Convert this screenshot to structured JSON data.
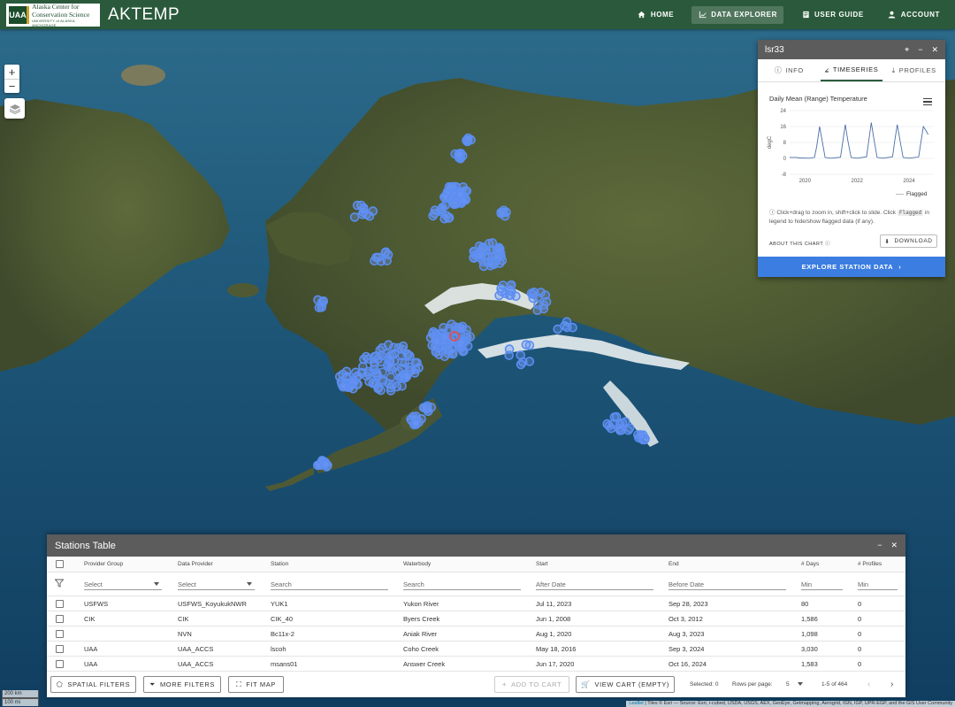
{
  "app": {
    "logo_mark": "UAA",
    "logo_line1": "Alaska Center for",
    "logo_line2": "Conservation Science",
    "logo_line3": "UNIVERSITY of ALASKA ANCHORAGE",
    "title": "AKTEMP"
  },
  "nav": {
    "home": "HOME",
    "explorer": "DATA EXPLORER",
    "guide": "USER GUIDE",
    "account": "ACCOUNT"
  },
  "map": {
    "zoom_in": "+",
    "zoom_out": "−",
    "scale_km": "200 km",
    "scale_mi": "100 mi",
    "attribution_link": "Leaflet",
    "attribution": " | Tiles © Esri — Source: Esri, i-cubed, USDA, USGS, AEX, GeoEye, Getmapping, Aerogrid, IGN, IGP, UPR-EGP, and the GIS User Community"
  },
  "station_panel": {
    "title": "lsr33",
    "tabs": [
      "INFO",
      "TIMESERIES",
      "PROFILES"
    ],
    "active_tab": "TIMESERIES",
    "hint_part1": "Click+drag to zoom in, shift+click to slide. Click ",
    "hint_code": "Flagged",
    "hint_part2": " in legend to hide/show flagged data (if any).",
    "about_label": "ABOUT THIS CHART",
    "download_label": "DOWNLOAD",
    "explore_label": "EXPLORE STATION DATA"
  },
  "chart_data": {
    "type": "line",
    "title": "Daily Mean (Range) Temperature",
    "ylabel": "degC",
    "xlabel": "",
    "ylim": [
      -8,
      24
    ],
    "yticks": [
      24,
      16,
      8,
      0,
      -8
    ],
    "xticks": [
      "2020",
      "2022",
      "2024"
    ],
    "xlim": [
      "2019-06-01",
      "2024-12-01"
    ],
    "legend": [
      "Flagged"
    ],
    "legend_position": "bottom-right",
    "grid": true,
    "series": [
      {
        "name": "Daily Mean",
        "x": [
          "2019-06-01",
          "2019-09-01",
          "2019-10-15",
          "2020-03-01",
          "2020-05-15",
          "2020-06-15",
          "2020-07-25",
          "2020-08-25",
          "2020-10-10",
          "2021-01-01",
          "2021-05-15",
          "2021-06-15",
          "2021-07-20",
          "2021-08-25",
          "2021-10-10",
          "2022-01-01",
          "2022-05-15",
          "2022-06-15",
          "2022-07-20",
          "2022-08-25",
          "2022-10-10",
          "2023-01-01",
          "2023-05-15",
          "2023-06-15",
          "2023-07-20",
          "2023-08-25",
          "2023-10-10",
          "2024-01-01",
          "2024-05-15",
          "2024-06-15",
          "2024-07-20",
          "2024-08-25",
          "2024-09-25"
        ],
        "values": [
          0.5,
          0.5,
          0.2,
          0.1,
          0.5,
          6,
          16,
          10,
          0.5,
          0.1,
          0.6,
          8,
          17,
          9,
          0.5,
          0.1,
          0.8,
          9,
          18,
          10,
          0.5,
          0.1,
          0.8,
          9,
          17,
          9.5,
          0.5,
          0.1,
          0.7,
          8,
          16,
          14,
          12
        ]
      }
    ]
  },
  "stations_table": {
    "title": "Stations Table",
    "columns": [
      "Provider Group",
      "Data Provider",
      "Station",
      "Waterbody",
      "Start",
      "End",
      "# Days",
      "# Profiles"
    ],
    "filters": [
      "Select",
      "Select",
      "Search",
      "Search",
      "After Date",
      "Before Date",
      "Min",
      "Min"
    ],
    "rows": [
      [
        "USFWS",
        "USFWS_KoyukukNWR",
        "YUK1",
        "Yukon River",
        "Jul 11, 2023",
        "Sep 28, 2023",
        "80",
        "0"
      ],
      [
        "CIK",
        "CIK",
        "CIK_40",
        "Byers Creek",
        "Jun 1, 2008",
        "Oct 3, 2012",
        "1,586",
        "0"
      ],
      [
        "",
        "NVN",
        "Bc11x-2",
        "Aniak River",
        "Aug 1, 2020",
        "Aug 3, 2023",
        "1,098",
        "0"
      ],
      [
        "UAA",
        "UAA_ACCS",
        "lscoh",
        "Coho Creek",
        "May 18, 2016",
        "Sep 3, 2024",
        "3,030",
        "0"
      ],
      [
        "UAA",
        "UAA_ACCS",
        "msans01",
        "Answer Creek",
        "Jun 17, 2020",
        "Oct 16, 2024",
        "1,583",
        "0"
      ]
    ],
    "footer": {
      "spatial_filters": "SPATIAL FILTERS",
      "more_filters": "MORE FILTERS",
      "fit_map": "FIT MAP",
      "add_to_cart": "ADD TO CART",
      "view_cart": "VIEW CART (EMPTY)",
      "selected": "Selected: 0",
      "rows_per_page_label": "Rows per page:",
      "rows_per_page": "5",
      "range": "1-5 of 464"
    }
  },
  "colors": {
    "header_green": "#2a5a3b",
    "panel_header": "#5c5c5c",
    "accent_blue": "#3b7de0",
    "marker_blue": "#5b8ef0",
    "selected_marker": "#e05050"
  }
}
